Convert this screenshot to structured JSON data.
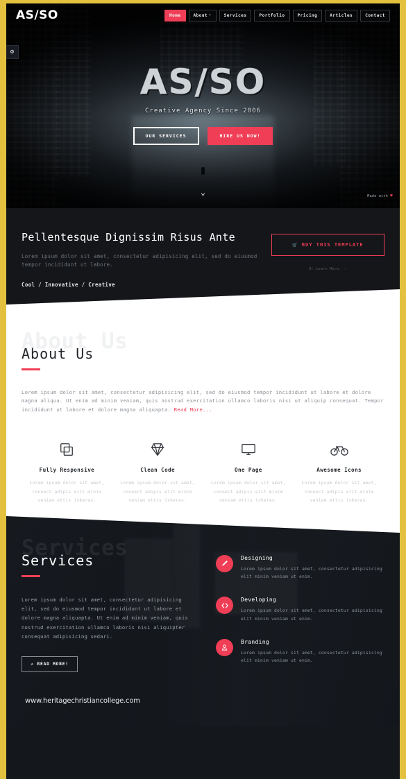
{
  "brand": "AS/SO",
  "nav": {
    "items": [
      {
        "label": "Home",
        "active": true
      },
      {
        "label": "About",
        "caret": "▾"
      },
      {
        "label": "Services"
      },
      {
        "label": "Portfolio"
      },
      {
        "label": "Pricing"
      },
      {
        "label": "Articles"
      },
      {
        "label": "Contact"
      }
    ]
  },
  "hero": {
    "title": "AS/SO",
    "subtitle": "Creative Agency Since 2006",
    "btn_services": "OUR SERVICES",
    "btn_hire": "HIRE US NOW!",
    "made_with": "Made with",
    "heart": "♥",
    "scroll_icon": "⌄"
  },
  "settings": {
    "icon": "⚙"
  },
  "promo": {
    "heading": "Pellentesque Dignissim Risus Ante",
    "paragraph": "Lorem ipsum dolor sit amet, consectetur adipisicing elit, sed do eiusmod tempor incididunt ut labore.",
    "tags": "Cool / Innovative / Creative",
    "buy_button": "BUY THIS TEMPLATE",
    "buy_icon": "🛒",
    "learn_more": "Or Learn More.",
    "learn_icon": "☞"
  },
  "about": {
    "ghost": "About Us",
    "title": "About Us",
    "paragraph": "Lorem ipsum dolor sit amet, consectetur adipisicing elit, sed do eiusmod tempor incididunt ut labore et dolore magna aliqua. Ut enim ad minim veniam, quis nostrud exercitation ullamco laboris nisi ut aliquip consequat. Tempor incididunt ut labore et dolore magna aliquapta.",
    "read_more": "Read More...",
    "features": [
      {
        "icon": "copy-icon",
        "title": "Fully Responsive",
        "text": "Lorem ipsum dolor sit amet, connect adipis elit minim veniam ettis iskeras."
      },
      {
        "icon": "diamond-icon",
        "title": "Clean Code",
        "text": "Lorem ipsum dolor sit amet, connect adipis elit minim veniam ettis iskeras."
      },
      {
        "icon": "monitor-icon",
        "title": "One Page",
        "text": "Lorem ipsum dolor sit amet, connect adipis elit minim veniam ettis iskeras."
      },
      {
        "icon": "bicycle-icon",
        "title": "Awesome Icons",
        "text": "Lorem ipsum dolor sit amet, connect adipis elit minim veniam ettis iskeras."
      }
    ]
  },
  "services": {
    "ghost": "Services",
    "title": "Services",
    "paragraph": "Lorem ipsum dolor sit amet, consectetur adipisicing elit, sed do eiusmod tempor incididunt ut labore et dolore magna aliquapta. Ut enim ad minim veniam, quis nostrud exercitation ullamco laboris nisi aliquipter consequat adipisicing sedari.",
    "read_button": "READ MORE!",
    "read_icon": "↗",
    "items": [
      {
        "icon": "brush-icon",
        "name": "Designing",
        "desc": "Lorem ipsum dolor sit amet, consectetur adipisicing elit minim veniam ut enim."
      },
      {
        "icon": "code-icon",
        "name": "Developing",
        "desc": "Lorem ipsum dolor sit amet, consectetur adipisicing elit minim veniam ut enim."
      },
      {
        "icon": "stamp-icon",
        "name": "Branding",
        "desc": "Lorem ipsum dolor sit amet, consectetur adipisicing elit minim veniam ut enim."
      }
    ]
  },
  "watermark": "www.heritagechristiancollege.com",
  "colors": {
    "accent": "#ef3e56",
    "dark": "#141619",
    "frame": "#e3c13e"
  }
}
